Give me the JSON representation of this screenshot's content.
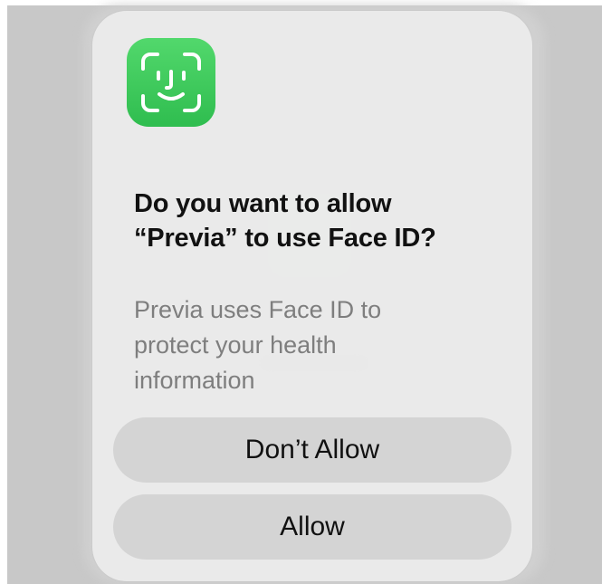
{
  "backdrop": {
    "color": "#c8c8c8"
  },
  "alert": {
    "icon": "face-id-icon",
    "icon_color": "#34c759",
    "title_lines": [
      "Do you want to allow",
      "“Previa” to use Face ID?"
    ],
    "message_lines": [
      "Previa uses Face ID to",
      "protect your health",
      "information"
    ],
    "buttons": {
      "deny_label": "Don’t Allow",
      "allow_label": "Allow"
    }
  }
}
